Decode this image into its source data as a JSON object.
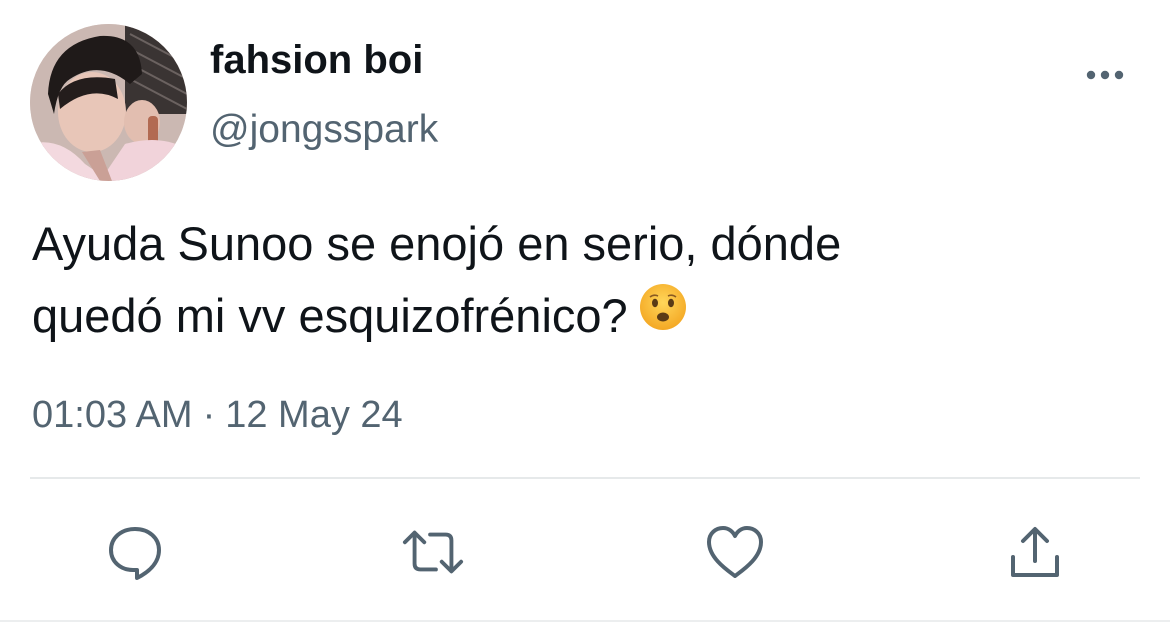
{
  "user": {
    "display_name": "fahsion boi",
    "handle": "@jongsspark",
    "avatar_icon": "profile-photo"
  },
  "tweet": {
    "text_line1": "Ayuda Sunoo se enojó en serio, dónde",
    "text_line2": "quedó mi vv esquizofrénico?",
    "emoji": "frowning-face-with-open-mouth",
    "time": "01:03 AM",
    "separator": "·",
    "date": "12 May 24"
  },
  "actions": {
    "reply_icon": "reply-icon",
    "retweet_icon": "retweet-icon",
    "like_icon": "heart-icon",
    "share_icon": "share-icon",
    "more_icon": "more-dots-icon"
  },
  "colors": {
    "text": "#0f1419",
    "secondary": "#536471",
    "divider": "#e6e9ea"
  }
}
